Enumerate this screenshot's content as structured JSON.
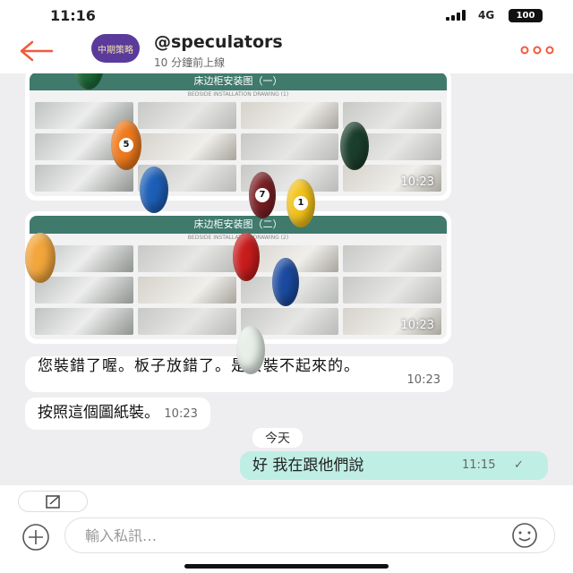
{
  "status_bar": {
    "time": "11:16",
    "network": "4G",
    "battery": "100"
  },
  "header": {
    "handle": "@speculators",
    "online_status": "10 分鐘前上線",
    "avatar_text": "中期策略"
  },
  "messages": [
    {
      "type": "image",
      "title": "床边柜安装图（一）",
      "subtitle": "BEDSIDE INSTALLATION DRAWING (1)",
      "time": "10:23"
    },
    {
      "type": "image",
      "title": "床边柜安装图（二）",
      "subtitle": "BEDSIDE INSTALLATION DRAWING (2)",
      "time": "10:23"
    },
    {
      "type": "text",
      "text": "您裝錯了喔。板子放錯了。是安裝不起來的。",
      "time": "10:23"
    },
    {
      "type": "text",
      "text": "按照這個圖紙裝。",
      "time": "10:23"
    }
  ],
  "date_divider": "今天",
  "outgoing": {
    "text": "好 我在跟他們說",
    "time": "11:15",
    "read_mark": "✓"
  },
  "composer": {
    "placeholder": "輸入私訊…"
  },
  "balls": [
    {
      "color": "#1d6b3a",
      "number": ""
    },
    {
      "color": "#f07a1c",
      "number": "5"
    },
    {
      "color": "#1d5fb8",
      "number": ""
    },
    {
      "color": "#1b3f2c",
      "number": ""
    },
    {
      "color": "#7a1f23",
      "number": "7"
    },
    {
      "color": "#f3c319",
      "number": "1"
    },
    {
      "color": "#f2a63b",
      "number": ""
    },
    {
      "color": "#c91c1c",
      "number": ""
    },
    {
      "color": "#1b4aa0",
      "number": ""
    },
    {
      "color": "#e6efe8",
      "number": ""
    }
  ]
}
